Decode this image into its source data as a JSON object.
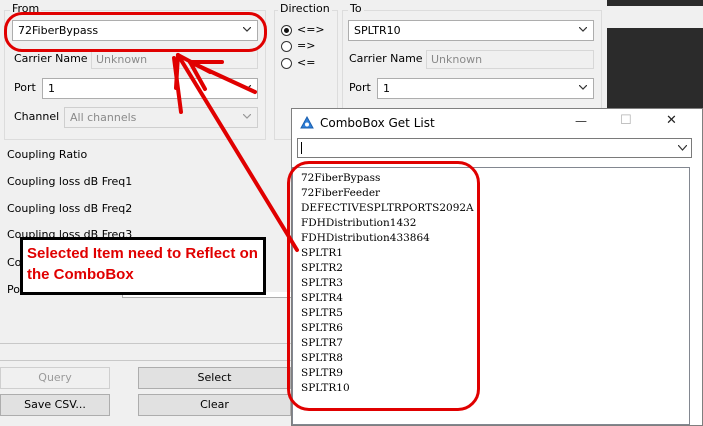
{
  "from_group": {
    "legend": "From",
    "from_combo": "72FiberBypass",
    "carrier_name_label": "Carrier Name",
    "carrier_name_value": "Unknown",
    "port_label": "Port",
    "port_value": "1",
    "channel_label": "Channel",
    "channel_value": "All channels"
  },
  "direction_group": {
    "legend": "Direction",
    "options": [
      "<=>",
      "=>",
      "<="
    ],
    "selected_index": 0
  },
  "to_group": {
    "legend": "To",
    "to_combo": "SPLTR10",
    "carrier_name_label": "Carrier Name",
    "carrier_name_value": "Unknown",
    "port_label": "Port",
    "port_value": "1"
  },
  "fields": {
    "coupling_ratio": "Coupling Ratio",
    "loss_freq1": "Coupling loss dB Freq1",
    "loss_freq2": "Coupling loss dB Freq2",
    "loss_freq3": "Coupling loss dB Freq3",
    "partial_co": "Co",
    "partial_po": "Po"
  },
  "buttons": {
    "query": "Query",
    "select": "Select",
    "save_csv": "Save CSV...",
    "clear": "Clear"
  },
  "dialog": {
    "title": "ComboBox Get List",
    "minimize": "—",
    "maximize": "☐",
    "close": "✕",
    "items": [
      "72FiberBypass",
      "72FiberFeeder",
      "DEFECTIVESPLTRPORTS2092A",
      "FDHDistribution1432",
      "FDHDistribution433864",
      "SPLTR1",
      "SPLTR2",
      "SPLTR3",
      "SPLTR4",
      "SPLTR5",
      "SPLTR6",
      "SPLTR7",
      "SPLTR8",
      "SPLTR9",
      "SPLTR10"
    ]
  },
  "annotation": {
    "text": "Selected Item need to Reflect on the ComboBox",
    "color": "#e00000"
  },
  "icons": [
    "chevron-down-icon",
    "app-icon",
    "minimize-icon",
    "maximize-icon",
    "close-icon"
  ]
}
